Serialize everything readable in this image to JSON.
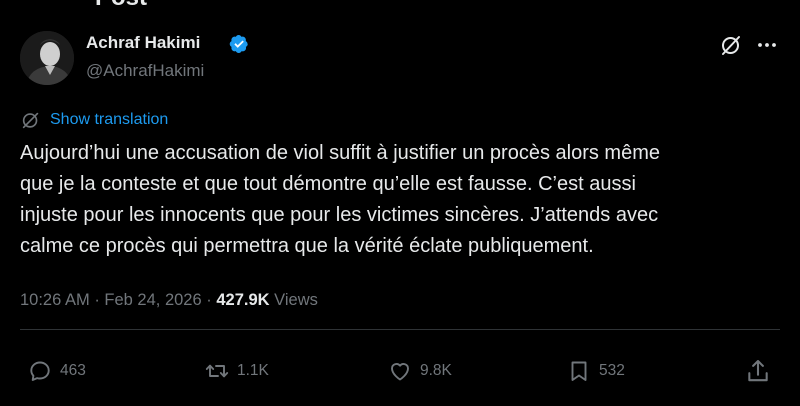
{
  "header": {
    "title": "Post"
  },
  "author": {
    "name": "Achraf Hakimi",
    "handle": "@AchrafHakimi",
    "verified": true,
    "verified_color": "#1d9bf0"
  },
  "translate": {
    "label": "Show translation",
    "icon": "translate-icon"
  },
  "post": {
    "lines": [
      "Aujourd’hui une accusation de viol suffit à justifier un procès alors même",
      "que je la conteste et que tout démontre qu’elle est fausse. C’est aussi",
      "injuste pour les innocents que pour les victimes sincères. J’attends avec",
      "calme ce procès qui permettra que la vérité éclate publiquement."
    ],
    "time": "10:26 AM",
    "separator": "·",
    "date": "Feb 24, 2026",
    "views_count": "427.9K",
    "views_label": "Views"
  },
  "actions": {
    "replies": "463",
    "reposts": "1.1K",
    "likes": "9.8K",
    "bookmarks": "532"
  },
  "colors": {
    "background": "#000000",
    "text": "#e7e9ea",
    "muted": "#71767b",
    "accent": "#1d9bf0",
    "divider": "#2f3336"
  }
}
